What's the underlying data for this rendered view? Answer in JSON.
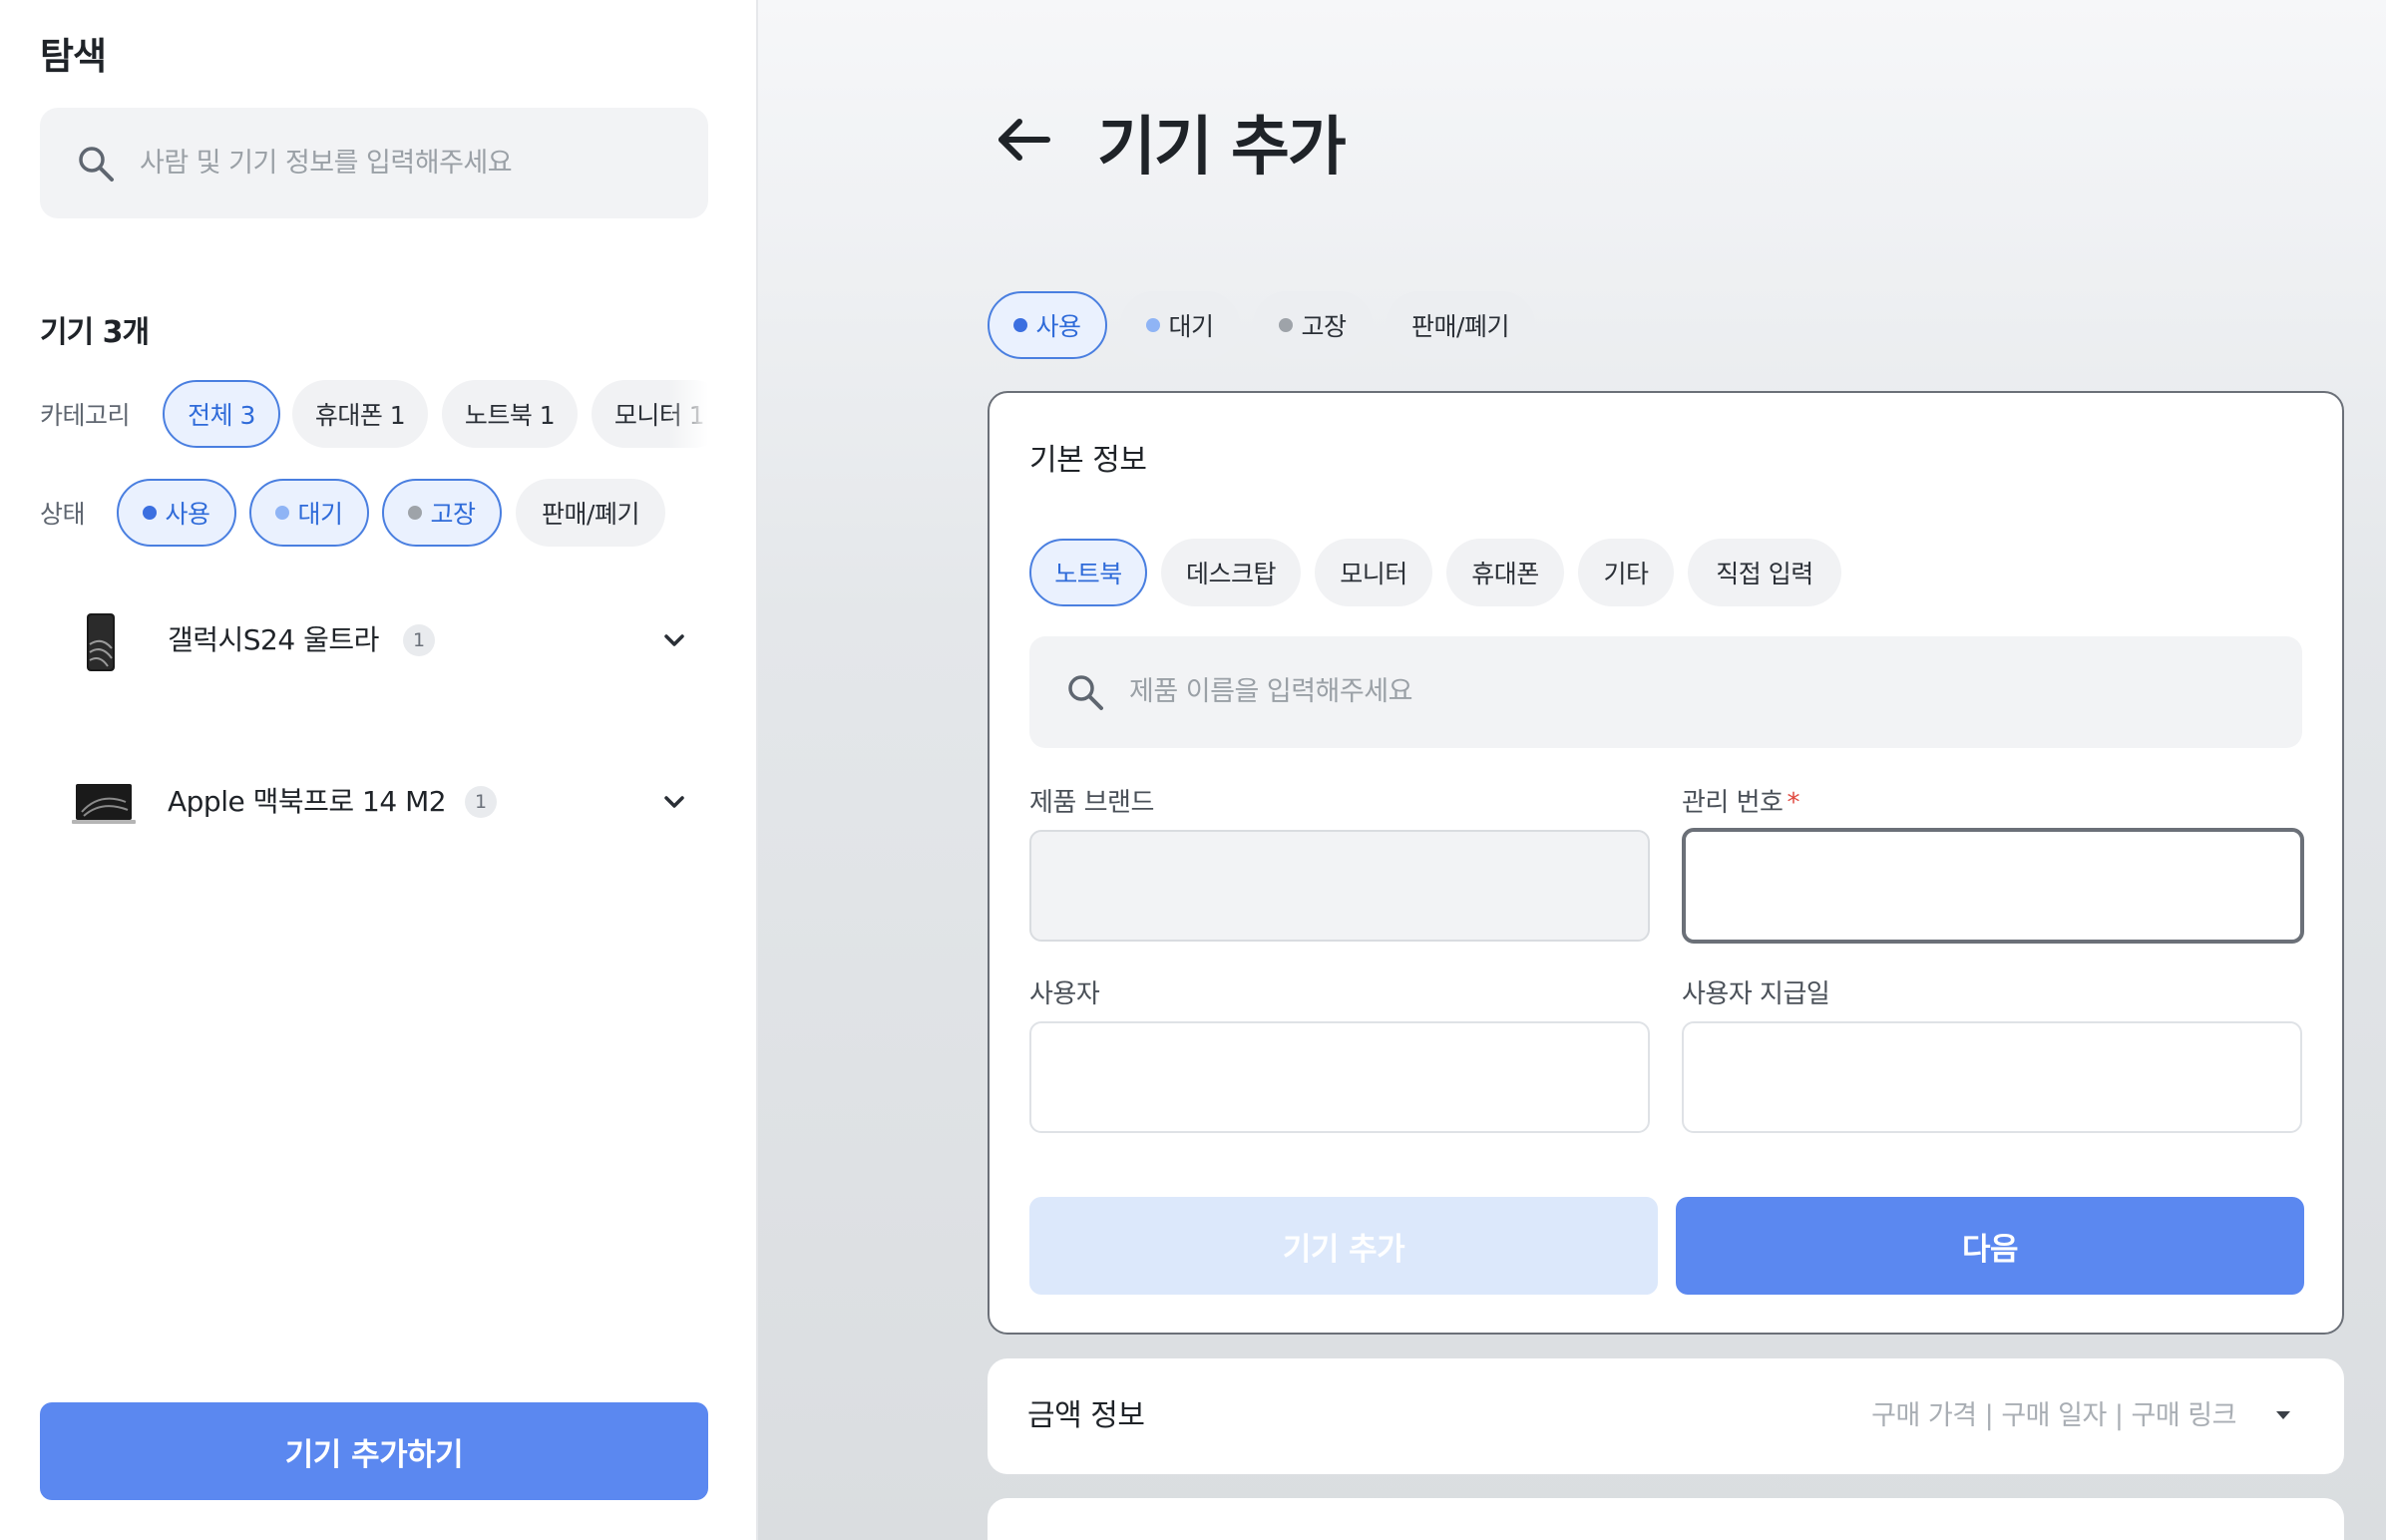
{
  "sidebar": {
    "title": "탐색",
    "search": {
      "placeholder": "사람 및 기기 정보를 입력해주세요"
    },
    "device_count": "기기 3개",
    "category_label": "카테고리",
    "categories": [
      {
        "label": "전체 3",
        "selected": true
      },
      {
        "label": "휴대폰 1",
        "selected": false
      },
      {
        "label": "노트북 1",
        "selected": false
      },
      {
        "label": "모니터 1",
        "selected": false
      }
    ],
    "status_label": "상태",
    "statuses": [
      {
        "label": "사용",
        "selected": true,
        "dot_color": "#3b6fe0"
      },
      {
        "label": "대기",
        "selected": true,
        "dot_color": "#8fb4f5"
      },
      {
        "label": "고장",
        "selected": true,
        "dot_color": "#9ea3a9"
      },
      {
        "label": "판매/폐기",
        "selected": false
      }
    ],
    "devices": [
      {
        "name": "갤럭시S24 울트라",
        "count": "1",
        "icon": "phone-thumbnail"
      },
      {
        "name": "Apple 맥북프로 14 M2",
        "count": "1",
        "icon": "laptop-thumbnail"
      }
    ],
    "add_button": "기기 추가하기"
  },
  "main": {
    "title": "기기 추가",
    "status_chips": [
      {
        "label": "사용",
        "selected": true,
        "dot_color": "#3b6fe0"
      },
      {
        "label": "대기",
        "selected": false,
        "dot_color": "#8fb4f5"
      },
      {
        "label": "고장",
        "selected": false,
        "dot_color": "#9ea3a9"
      },
      {
        "label": "판매/폐기",
        "selected": false
      }
    ],
    "basic_info": {
      "title": "기본 정보",
      "types": [
        {
          "label": "노트북",
          "selected": true
        },
        {
          "label": "데스크탑",
          "selected": false
        },
        {
          "label": "모니터",
          "selected": false
        },
        {
          "label": "휴대폰",
          "selected": false
        },
        {
          "label": "기타",
          "selected": false
        },
        {
          "label": "직접 입력",
          "selected": false
        }
      ],
      "product_search_placeholder": "제품 이름을 입력해주세요",
      "fields": {
        "brand": {
          "label": "제품 브랜드",
          "value": ""
        },
        "asset_number": {
          "label": "관리 번호",
          "required_mark": "*",
          "value": ""
        },
        "user": {
          "label": "사용자",
          "value": ""
        },
        "issue_date": {
          "label": "사용자 지급일",
          "value": ""
        }
      },
      "add_button": "기기 추가",
      "next_button": "다음"
    },
    "price_info": {
      "title": "금액 정보",
      "hint": "구매 가격 | 구매 일자 | 구매 링크"
    }
  },
  "colors": {
    "accent": "#5b88f0",
    "accent_light": "#dce8fb",
    "selected_chip_bg": "#eaf1fe",
    "selected_chip_text": "#2f6bd9",
    "required": "#e0473d"
  }
}
